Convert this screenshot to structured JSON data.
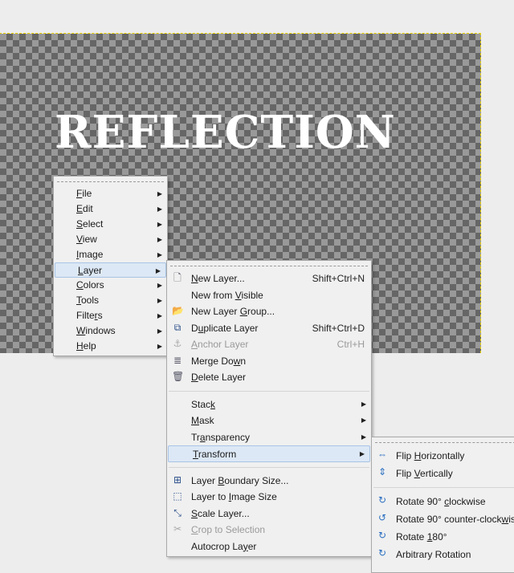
{
  "canvas": {
    "text": "REFLECTION"
  },
  "main_menu": {
    "items": [
      {
        "pre": "",
        "u": "F",
        "post": "ile"
      },
      {
        "pre": "",
        "u": "E",
        "post": "dit"
      },
      {
        "pre": "",
        "u": "S",
        "post": "elect"
      },
      {
        "pre": "",
        "u": "V",
        "post": "iew"
      },
      {
        "pre": "",
        "u": "I",
        "post": "mage"
      },
      {
        "pre": "",
        "u": "L",
        "post": "ayer"
      },
      {
        "pre": "",
        "u": "C",
        "post": "olors"
      },
      {
        "pre": "",
        "u": "T",
        "post": "ools"
      },
      {
        "pre": "Filte",
        "u": "r",
        "post": "s"
      },
      {
        "pre": "",
        "u": "W",
        "post": "indows"
      },
      {
        "pre": "",
        "u": "H",
        "post": "elp"
      }
    ],
    "arrow": "▶"
  },
  "layer_menu": {
    "new_layer": {
      "pre": "",
      "u": "N",
      "post": "ew Layer...",
      "accel": "Shift+Ctrl+N"
    },
    "new_from_visible": {
      "pre": "New from ",
      "u": "V",
      "post": "isible"
    },
    "new_layer_group": {
      "pre": "New Layer ",
      "u": "G",
      "post": "roup..."
    },
    "duplicate_layer": {
      "pre": "D",
      "u": "u",
      "post": "plicate Layer",
      "accel": "Shift+Ctrl+D"
    },
    "anchor_layer": {
      "pre": "",
      "u": "A",
      "post": "nchor Layer",
      "accel": "Ctrl+H"
    },
    "merge_down": {
      "pre": "Merge Do",
      "u": "w",
      "post": "n"
    },
    "delete_layer": {
      "pre": "",
      "u": "D",
      "post": "elete Layer"
    },
    "stack": {
      "pre": "Stac",
      "u": "k",
      "post": ""
    },
    "mask": {
      "pre": "",
      "u": "M",
      "post": "ask"
    },
    "transparency": {
      "pre": "Tr",
      "u": "a",
      "post": "nsparency"
    },
    "transform": {
      "pre": "",
      "u": "T",
      "post": "ransform"
    },
    "layer_boundary_size": {
      "pre": "Layer ",
      "u": "B",
      "post": "oundary Size..."
    },
    "layer_to_image_size": {
      "pre": "Layer to ",
      "u": "I",
      "post": "mage Size"
    },
    "scale_layer": {
      "pre": "",
      "u": "S",
      "post": "cale Layer..."
    },
    "crop_to_selection": {
      "pre": "",
      "u": "C",
      "post": "rop to Selection"
    },
    "autocrop_layer": {
      "pre": "Autocrop La",
      "u": "y",
      "post": "er"
    }
  },
  "transform_menu": {
    "flip_h": {
      "pre": "Flip ",
      "u": "H",
      "post": "orizontally"
    },
    "flip_v": {
      "pre": "Flip ",
      "u": "V",
      "post": "ertically"
    },
    "rot_cw": {
      "pre": "Rotate 90° ",
      "u": "c",
      "post": "lockwise"
    },
    "rot_ccw": {
      "pre": "Rotate 90° counter-clock",
      "u": "w",
      "post": "ise"
    },
    "rot_180": {
      "pre": "Rotate ",
      "u": "1",
      "post": "80°"
    },
    "arbitrary": {
      "pre": "Arbitrary Rotation",
      "u": "",
      "post": ""
    }
  },
  "icons": {
    "new_layer": "🗋",
    "new_layer_group": "📂",
    "duplicate": "⧉",
    "anchor": "⚓",
    "merge": "≣",
    "delete": "🗑",
    "boundary": "⊞",
    "to_image": "⬚",
    "scale": "⤡",
    "crop": "✂",
    "flip_h": "⇔",
    "flip_v": "⇕",
    "rot": "↻",
    "rot_ccw": "↺"
  }
}
